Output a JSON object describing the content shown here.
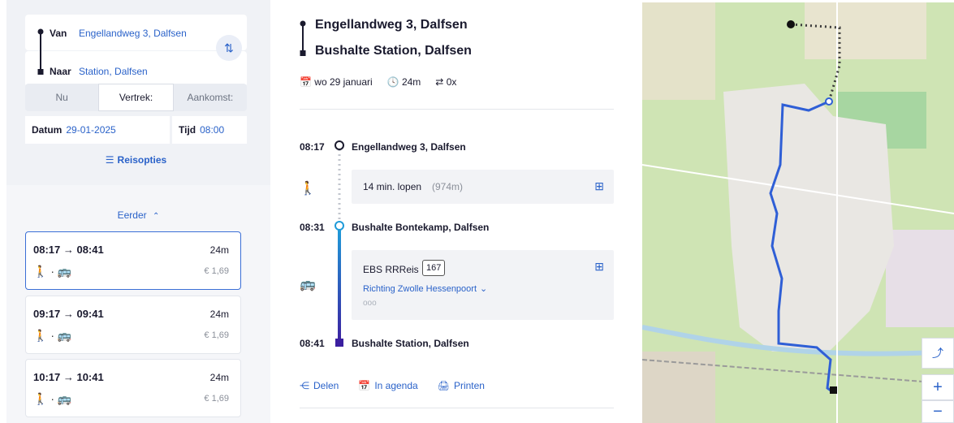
{
  "planner": {
    "from_label": "Van",
    "from_value": "Engellandweg 3, Dalfsen",
    "to_label": "Naar",
    "to_value": "Station, Dalfsen",
    "tabs": [
      "Nu",
      "Vertrek:",
      "Aankomst:"
    ],
    "date_label": "Datum",
    "date_value": "29-01-2025",
    "time_label": "Tijd",
    "time_value": "08:00",
    "options_label": "Reisopties"
  },
  "results": {
    "earlier_label": "Eerder",
    "items": [
      {
        "times": "08:17 → 08:41",
        "duration": "24m",
        "price": "€ 1,69"
      },
      {
        "times": "09:17 → 09:41",
        "duration": "24m",
        "price": "€ 1,69"
      },
      {
        "times": "10:17 → 10:41",
        "duration": "24m",
        "price": "€ 1,69"
      }
    ]
  },
  "detail": {
    "from": "Engellandweg 3, Dalfsen",
    "to": "Bushalte Station, Dalfsen",
    "date": "wo 29 januari",
    "duration": "24m",
    "transfers": "0x",
    "stops": [
      {
        "time": "08:17",
        "name": "Engellandweg 3, Dalfsen"
      },
      {
        "time": "08:31",
        "name": "Bushalte Bontekamp, Dalfsen"
      },
      {
        "time": "08:41",
        "name": "Bushalte Station, Dalfsen"
      }
    ],
    "walk_text": "14 min. lopen",
    "walk_distance": "(974m)",
    "bus_operator": "EBS RRReis",
    "bus_line": "167",
    "bus_direction": "Richting Zwolle Hessenpoort",
    "actions": [
      "Delen",
      "In agenda",
      "Printen"
    ]
  },
  "colors": {
    "accent": "#2a62c9",
    "route_walk": "#b9bec8",
    "route_bus_start": "#1f9bd9",
    "route_bus_end": "#3b1fa0",
    "map_route": "#2f5fd6"
  }
}
